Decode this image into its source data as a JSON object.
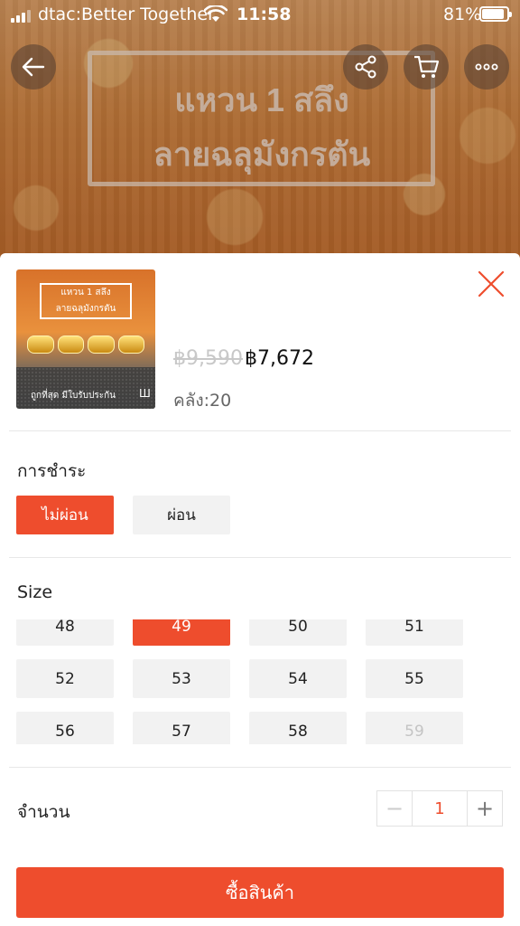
{
  "status_bar": {
    "carrier": "dtac:Better Together",
    "time": "11:58",
    "battery": "81%"
  },
  "background": {
    "title_line1": "แหวน 1 สลึง",
    "title_line2": "ลายฉลุมังกรตัน"
  },
  "header_icons": [
    "back-arrow-icon",
    "share-icon",
    "cart-icon",
    "more-icon"
  ],
  "product": {
    "thumb_title_line1": "แหวน 1 สลึง",
    "thumb_title_line2": "ลายฉลุมังกรตัน",
    "thumb_caption": "ถูกที่สุด มีใบรับประกัน",
    "old_price": "฿9,590",
    "price": "฿7,672",
    "stock": "คลัง:20"
  },
  "payment": {
    "label": "การชำระ",
    "options": [
      {
        "label": "ไม่ผ่อน",
        "selected": true
      },
      {
        "label": "ผ่อน",
        "selected": false
      }
    ]
  },
  "size": {
    "label": "Size",
    "options": [
      {
        "label": "48",
        "state": "normal"
      },
      {
        "label": "49",
        "state": "selected"
      },
      {
        "label": "50",
        "state": "normal"
      },
      {
        "label": "51",
        "state": "normal"
      },
      {
        "label": "52",
        "state": "normal"
      },
      {
        "label": "53",
        "state": "normal"
      },
      {
        "label": "54",
        "state": "normal"
      },
      {
        "label": "55",
        "state": "normal"
      },
      {
        "label": "56",
        "state": "normal"
      },
      {
        "label": "57",
        "state": "normal"
      },
      {
        "label": "58",
        "state": "normal"
      },
      {
        "label": "59",
        "state": "disabled"
      }
    ]
  },
  "quantity": {
    "label": "จำนวน",
    "value": "1",
    "minus": "−",
    "plus": "+"
  },
  "buy_button": {
    "label": "ซื้อสินค้า"
  },
  "colors": {
    "accent": "#ee4d2d",
    "option_bg": "#f2f2f2",
    "disabled_text": "#c4c4c4"
  }
}
